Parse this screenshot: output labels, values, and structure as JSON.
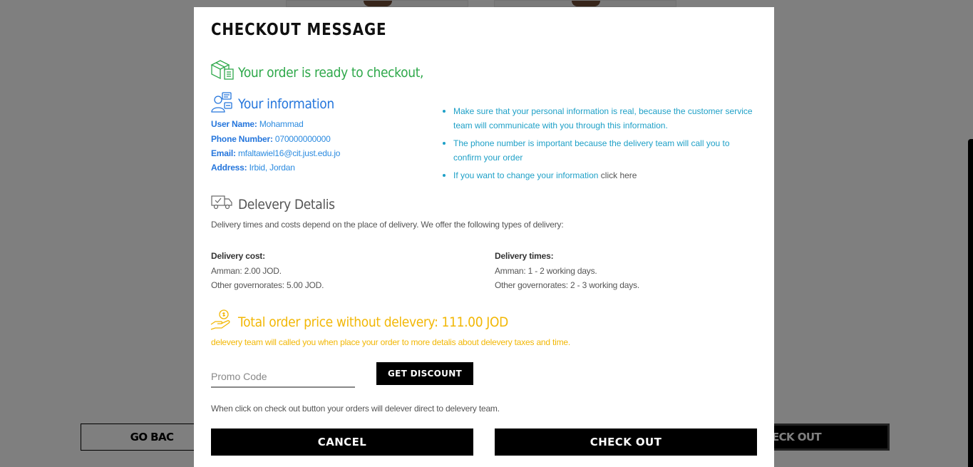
{
  "modal": {
    "title": "CHECKOUT MESSAGE",
    "ready_text": "Your order is ready to checkout,",
    "info": {
      "heading": "Your information",
      "user_label": "User Name:",
      "user_value": "Mohammad",
      "phone_label": "Phone Number:",
      "phone_value": "070000000000",
      "email_label": "Email:",
      "email_value": "mfaltawiel16@cit.just.edu.jo",
      "address_label": "Address:",
      "address_value": "Irbid, Jordan",
      "notes": [
        "Make sure that your personal information is real, because the customer service team will communicate with you through this information.",
        "The phone number is important because the delivery team will call you to confirm your order",
        "If you want to change your information "
      ],
      "click_here": "click here"
    },
    "delivery": {
      "heading": "Delevery Detalis",
      "intro": "Delivery times and costs depend on the place of delivery. We offer the following types of delivery:",
      "cost_label": "Delivery cost:",
      "cost_amman": "Amman: 2.00 JOD.",
      "cost_other": "Other governorates: 5.00 JOD.",
      "times_label": "Delivery times:",
      "times_amman": "Amman: 1 - 2 working days.",
      "times_other": "Other governorates: 2 - 3 working days."
    },
    "total": {
      "heading": "Total order price without delevery: 111.00 JOD",
      "note": "delevery team will called you when place your order to more detalis about delevery taxes and time."
    },
    "promo": {
      "placeholder": "Promo Code",
      "button": "GET DISCOUNT"
    },
    "footer_note": "When click on check out button your orders will delever direct to delevery team.",
    "cancel_label": "CANCEL",
    "checkout_label": "CHECK OUT"
  },
  "background": {
    "go_back_label": "GO BAC",
    "check_out_label": "ECK OUT"
  },
  "colors": {
    "green": "#2ea84a",
    "blue": "#2576dc",
    "cyan": "#1ea0c7",
    "yellow": "#f2b705"
  }
}
